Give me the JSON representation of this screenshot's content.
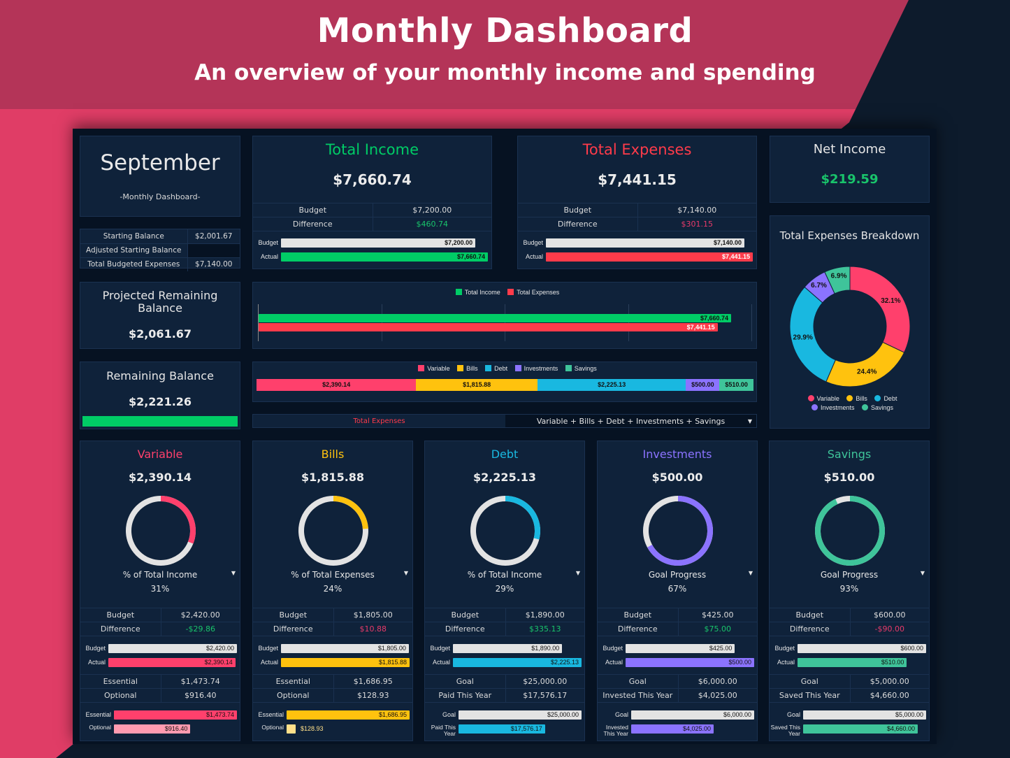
{
  "header": {
    "title": "Monthly Dashboard",
    "subtitle": "An overview of your monthly income and spending"
  },
  "colors": {
    "income": "#00cc66",
    "expenses": "#ff3b4a",
    "variable": "#ff406c",
    "variable_light": "#ff9bb0",
    "bills": "#ffc20e",
    "bills_light": "#ffe08a",
    "debt": "#19b8e0",
    "investments": "#8b73ff",
    "savings": "#3fc49a",
    "positive": "#19c46b",
    "negative": "#e83a6a",
    "track": "#e3e3e3"
  },
  "month_card": {
    "month": "September",
    "subtitle": "-Monthly Dashboard-"
  },
  "balances": [
    {
      "label": "Starting Balance",
      "value": "$2,001.67"
    },
    {
      "label": "Adjusted Starting Balance",
      "value": ""
    },
    {
      "label": "Total Budgeted Expenses",
      "value": "$7,140.00"
    }
  ],
  "projected": {
    "title": "Projected Remaining Balance",
    "value": "$2,061.67"
  },
  "remaining": {
    "title": "Remaining Balance",
    "value": "$2,221.26",
    "progress": 1.0
  },
  "income": {
    "title": "Total Income",
    "value": "$7,660.74",
    "budget_label": "Budget",
    "budget": "$7,200.00",
    "diff_label": "Difference",
    "diff": "$460.74",
    "bar_budget_label": "Budget",
    "bar_actual_label": "Actual",
    "bar_budget": 7200.0,
    "bar_actual": 7660.74,
    "bar_budget_text": "$7,200.00",
    "bar_actual_text": "$7,660.74"
  },
  "expenses": {
    "title": "Total Expenses",
    "value": "$7,441.15",
    "budget_label": "Budget",
    "budget": "$7,140.00",
    "diff_label": "Difference",
    "diff": "$301.15",
    "bar_budget_label": "Budget",
    "bar_actual_label": "Actual",
    "bar_budget": 7140.0,
    "bar_actual": 7441.15,
    "bar_budget_text": "$7,140.00",
    "bar_actual_text": "$7,441.15"
  },
  "net": {
    "title": "Net Income",
    "value": "$219.59"
  },
  "breakdown": {
    "title": "Total Expenses Breakdown"
  },
  "selector": {
    "label": "Total Expenses",
    "value": "Variable + Bills + Debt + Investments + Savings"
  },
  "chart_data": [
    {
      "type": "bar",
      "orientation": "horizontal",
      "title": "",
      "legend": "top",
      "categories": [
        ""
      ],
      "series": [
        {
          "name": "Total Income",
          "values": [
            7660.74
          ],
          "label": "$7,660.74"
        },
        {
          "name": "Total Expenses",
          "values": [
            7441.15
          ],
          "label": "$7,441.15"
        }
      ],
      "xlim": [
        0,
        8000
      ],
      "grid": true
    },
    {
      "type": "bar",
      "orientation": "horizontal-stacked",
      "title": "",
      "legend": "top",
      "series": [
        {
          "name": "Variable",
          "values": [
            2390.14
          ],
          "label": "$2,390.14"
        },
        {
          "name": "Bills",
          "values": [
            1815.88
          ],
          "label": "$1,815.88"
        },
        {
          "name": "Debt",
          "values": [
            2225.13
          ],
          "label": "$2,225.13"
        },
        {
          "name": "Investments",
          "values": [
            500.0
          ],
          "label": "$500.00"
        },
        {
          "name": "Savings",
          "values": [
            510.0
          ],
          "label": "$510.00"
        }
      ]
    },
    {
      "type": "pie",
      "donut": true,
      "title": "Total Expenses Breakdown",
      "legend": "bottom",
      "categories": [
        "Variable",
        "Bills",
        "Debt",
        "Investments",
        "Savings"
      ],
      "values": [
        32.1,
        24.4,
        29.9,
        6.7,
        6.9
      ],
      "labels": [
        "32.1%",
        "24.4%",
        "29.9%",
        "6.7%",
        "6.9%"
      ]
    }
  ],
  "categories": [
    {
      "key": "variable",
      "title": "Variable",
      "amount": "$2,390.14",
      "metric": "% of Total Income",
      "metric_value": "31%",
      "ring": 0.31,
      "budget_label": "Budget",
      "budget": "$2,420.00",
      "diff_label": "Difference",
      "diff": "-$29.86",
      "diff_sign": "positive",
      "bar_budget": 2420.0,
      "bar_actual": 2390.14,
      "bar_budget_text": "$2,420.00",
      "bar_actual_text": "$2,390.14",
      "row3_label": "Essential",
      "row3": "$1,473.74",
      "row4_label": "Optional",
      "row4": "$916.40",
      "b3_label": "Essential",
      "b4_label": "Optional",
      "b3": 1473.74,
      "b4": 916.4,
      "b3_text": "$1,473.74",
      "b4_text": "$916.40",
      "b3_max": 1473.74
    },
    {
      "key": "bills",
      "title": "Bills",
      "amount": "$1,815.88",
      "metric": "% of Total Expenses",
      "metric_value": "24%",
      "ring": 0.24,
      "budget_label": "Budget",
      "budget": "$1,805.00",
      "diff_label": "Difference",
      "diff": "$10.88",
      "diff_sign": "negative",
      "bar_budget": 1805.0,
      "bar_actual": 1815.88,
      "bar_budget_text": "$1,805.00",
      "bar_actual_text": "$1,815.88",
      "row3_label": "Essential",
      "row3": "$1,686.95",
      "row4_label": "Optional",
      "row4": "$128.93",
      "b3_label": "Essential",
      "b4_label": "Optional",
      "b3": 1686.95,
      "b4": 128.93,
      "b3_text": "$1,686.95",
      "b4_text": "$128.93",
      "b3_max": 1686.95
    },
    {
      "key": "debt",
      "title": "Debt",
      "amount": "$2,225.13",
      "metric": "% of Total Income",
      "metric_value": "29%",
      "ring": 0.29,
      "budget_label": "Budget",
      "budget": "$1,890.00",
      "diff_label": "Difference",
      "diff": "$335.13",
      "diff_sign": "positive",
      "bar_budget": 1890.0,
      "bar_actual": 2225.13,
      "bar_budget_text": "$1,890.00",
      "bar_actual_text": "$2,225.13",
      "row3_label": "Goal",
      "row3": "$25,000.00",
      "row4_label": "Paid This Year",
      "row4": "$17,576.17",
      "b3_label": "Goal",
      "b4_label": "Paid This Year",
      "b3": 25000.0,
      "b4": 17576.17,
      "b3_text": "$25,000.00",
      "b4_text": "$17,576.17",
      "b3_max": 25000.0
    },
    {
      "key": "investments",
      "title": "Investments",
      "amount": "$500.00",
      "metric": "Goal Progress",
      "metric_value": "67%",
      "ring": 0.67,
      "budget_label": "Budget",
      "budget": "$425.00",
      "diff_label": "Difference",
      "diff": "$75.00",
      "diff_sign": "positive",
      "bar_budget": 425.0,
      "bar_actual": 500.0,
      "bar_budget_text": "$425.00",
      "bar_actual_text": "$500.00",
      "row3_label": "Goal",
      "row3": "$6,000.00",
      "row4_label": "Invested This Year",
      "row4": "$4,025.00",
      "b3_label": "Goal",
      "b4_label": "Invested This Year",
      "b3": 6000.0,
      "b4": 4025.0,
      "b3_text": "$6,000.00",
      "b4_text": "$4,025.00",
      "b3_max": 6000.0
    },
    {
      "key": "savings",
      "title": "Savings",
      "amount": "$510.00",
      "metric": "Goal Progress",
      "metric_value": "93%",
      "ring": 0.93,
      "budget_label": "Budget",
      "budget": "$600.00",
      "diff_label": "Difference",
      "diff": "-$90.00",
      "diff_sign": "negative",
      "bar_budget": 600.0,
      "bar_actual": 510.0,
      "bar_budget_text": "$600.00",
      "bar_actual_text": "$510.00",
      "row3_label": "Goal",
      "row3": "$5,000.00",
      "row4_label": "Saved This Year",
      "row4": "$4,660.00",
      "b3_label": "Goal",
      "b4_label": "Saved This Year",
      "b3": 5000.0,
      "b4": 4660.0,
      "b3_text": "$5,000.00",
      "b4_text": "$4,660.00",
      "b3_max": 5000.0
    }
  ]
}
